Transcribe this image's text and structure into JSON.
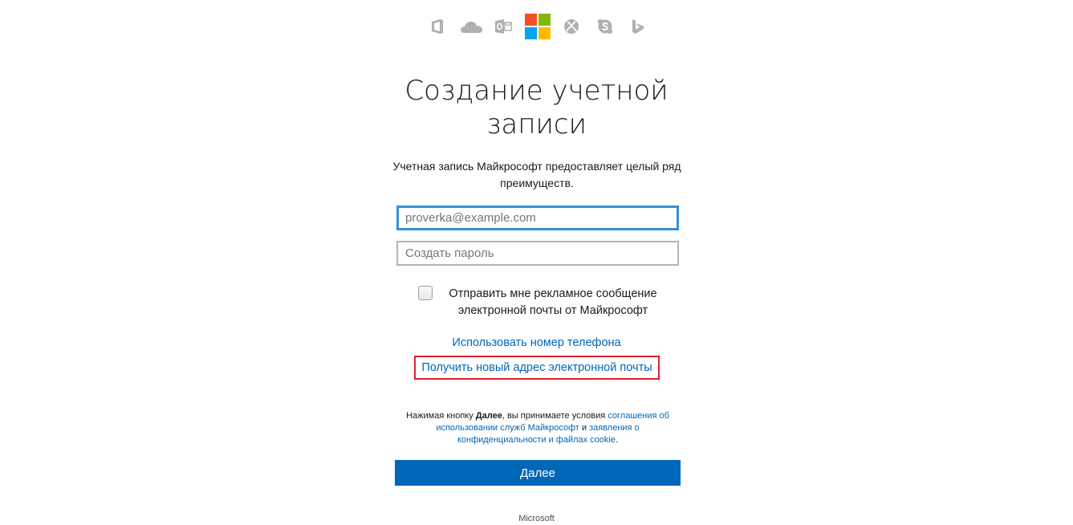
{
  "app_icons": [
    {
      "name": "office-icon",
      "color": "#b0b0b0"
    },
    {
      "name": "onedrive-icon",
      "color": "#b0b0b0"
    },
    {
      "name": "outlook-icon",
      "color": "#b0b0b0"
    },
    {
      "name": "microsoft-logo-icon",
      "colors": [
        "#f25022",
        "#7fba00",
        "#00a4ef",
        "#ffb900"
      ]
    },
    {
      "name": "xbox-icon",
      "color": "#b0b0b0"
    },
    {
      "name": "skype-icon",
      "color": "#b0b0b0"
    },
    {
      "name": "bing-icon",
      "color": "#b0b0b0"
    }
  ],
  "header": {
    "title_line1": "Создание учетной",
    "title_line2": "записи",
    "subtitle": "Учетная запись Майкрософт предоставляет целый ряд преимуществ."
  },
  "form": {
    "email_placeholder": "proverka@example.com",
    "password_placeholder": "Создать пароль",
    "promo_checkbox_label": "Отправить мне рекламное сообщение электронной почты от Майкрософт",
    "promo_checked": false,
    "use_phone_link": "Использовать номер телефона",
    "new_email_link": "Получить новый адрес электронной почты",
    "highlight_color": "#e0202a",
    "link_color": "#0067b8"
  },
  "terms": {
    "prefix": "Нажимая кнопку ",
    "bold": "Далее",
    "middle": ", вы принимаете условия ",
    "agreement_link": "соглашения об использовании служб Майкрософт",
    "and": " и ",
    "privacy_link": "заявления о конфиденциальности и файлах cookie",
    "suffix": "."
  },
  "actions": {
    "next_label": "Далее",
    "button_color": "#0067b8"
  },
  "footer": {
    "brand": "Microsoft"
  }
}
